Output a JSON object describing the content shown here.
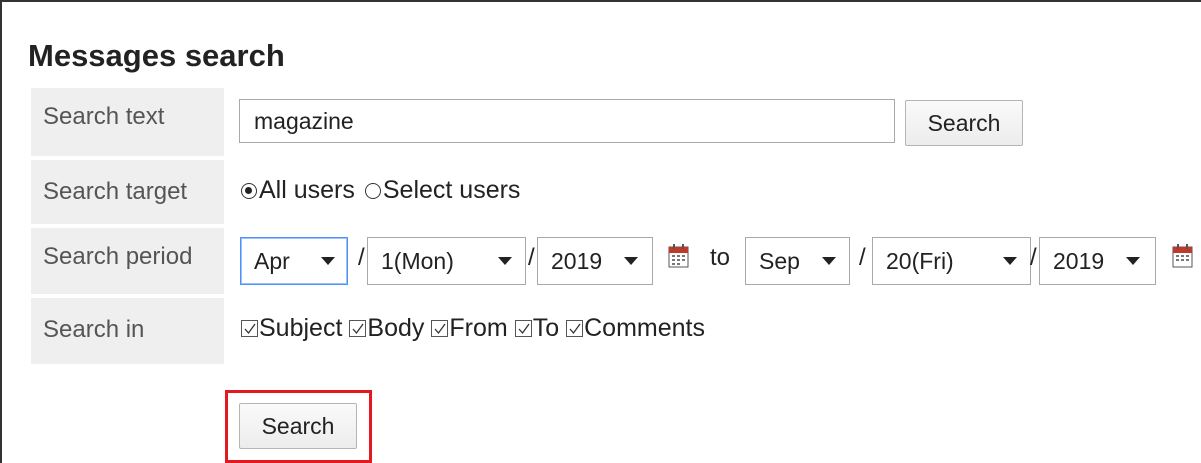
{
  "title": "Messages search",
  "search_text": {
    "label": "Search text",
    "value": "magazine",
    "button": "Search"
  },
  "search_target": {
    "label": "Search target",
    "options": [
      {
        "label": "All users",
        "selected": true
      },
      {
        "label": "Select users",
        "selected": false
      }
    ]
  },
  "search_period": {
    "label": "Search period",
    "from": {
      "month": "Apr",
      "day": "1(Mon)",
      "year": "2019"
    },
    "separator": "/",
    "to_label": "to",
    "to": {
      "month": "Sep",
      "day": "20(Fri)",
      "year": "2019"
    }
  },
  "search_in": {
    "label": "Search in",
    "options": [
      {
        "label": "Subject",
        "checked": true
      },
      {
        "label": "Body",
        "checked": true
      },
      {
        "label": "From",
        "checked": true
      },
      {
        "label": "To",
        "checked": true
      },
      {
        "label": "Comments",
        "checked": true
      }
    ]
  },
  "submit_button": "Search",
  "colors": {
    "label_bg": "#efefef",
    "highlight": "#e3191f",
    "focus": "#4d90fe",
    "calendar_icon": "#c0392b"
  },
  "icons": {
    "calendar": "calendar-icon",
    "dropdown": "chevron-down-icon"
  }
}
